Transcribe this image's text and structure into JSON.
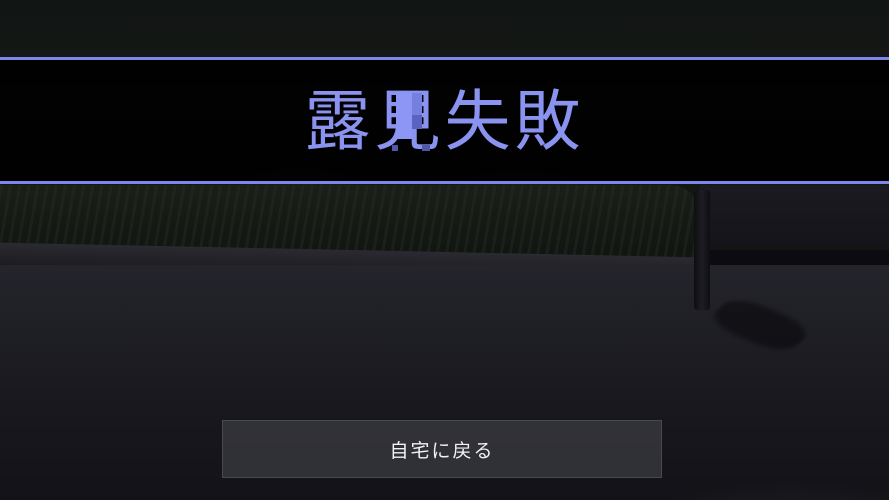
{
  "result": {
    "title": "露見失敗",
    "title_color": "#8a93f0",
    "banner_border_color": "#7d86ea"
  },
  "actions": {
    "return_home_label": "自宅に戻る"
  }
}
